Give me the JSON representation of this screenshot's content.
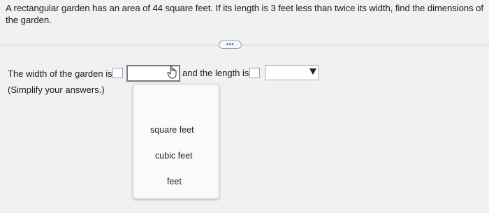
{
  "question": {
    "text": "A rectangular garden has an area of 44 square feet. If its length is 3 feet less than twice its width, find the dimensions of the garden."
  },
  "more_button": {
    "label": "•••"
  },
  "answer": {
    "width_label": "The width of the garden is",
    "length_label": "and the length is",
    "instruction": "(Simplify your answers.)",
    "width_value": "",
    "length_value": ""
  },
  "unit_dropdown": {
    "options": [
      "square feet",
      "cubic feet",
      "feet"
    ]
  },
  "icons": {
    "cursor": "hand-pointer-icon",
    "dropdown_arrow": "triangle-down-icon"
  },
  "colors": {
    "background": "#f1f1f2",
    "divider": "#c5c9cc",
    "more_button_border": "#8fa3bc"
  }
}
